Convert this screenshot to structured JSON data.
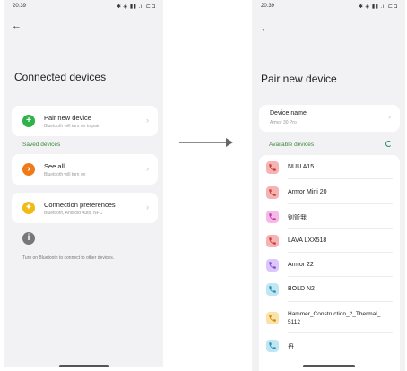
{
  "arrow_color": "#666666",
  "left": {
    "status": {
      "time": "20:39",
      "icons": "✱ ◈ ▮▮ .ıl ⊏⊐"
    },
    "title": "Connected devices",
    "pair": {
      "label": "Pair new device",
      "sub": "Bluetooth will turn on to pair"
    },
    "saved_header": "Saved devices",
    "see_all": {
      "label": "See all",
      "sub": "Bluetooth will turn on"
    },
    "conn_prefs": {
      "label": "Connection preferences",
      "sub": "Bluetooth, Android Auto, NFC"
    },
    "footer": "Turn on Bluetooth to connect to other devices."
  },
  "right": {
    "status": {
      "time": "20:39",
      "icons": "✱ ◈ ▮▮ .ıl ⊏⊐"
    },
    "title": "Pair new device",
    "device_name": {
      "label": "Device name",
      "value": "Armor 30 Pro"
    },
    "available_header": "Available devices",
    "devices": [
      {
        "name": "NUU A15",
        "kind": "phone",
        "color": "#f6b3b3",
        "ink": "#c43c3c"
      },
      {
        "name": "Armor Mini 20",
        "kind": "phone",
        "color": "#f6b3b3",
        "ink": "#c43c3c"
      },
      {
        "name": "别管我",
        "kind": "phone",
        "color": "#f6b8e8",
        "ink": "#b63ea0"
      },
      {
        "name": "LAVA LXX518",
        "kind": "phone",
        "color": "#f6b3b3",
        "ink": "#c43c3c"
      },
      {
        "name": "Armor 22",
        "kind": "phone",
        "color": "#dcc7fb",
        "ink": "#7c4ad0"
      },
      {
        "name": "BOLD N2",
        "kind": "phone",
        "color": "#bfe7f3",
        "ink": "#2a8fae"
      },
      {
        "name": "Hammer_Construction_2_Thermal_\n5112",
        "kind": "phone",
        "color": "#fbe3a8",
        "ink": "#c48a14"
      },
      {
        "name": "丹",
        "kind": "phone",
        "color": "#bfe7f3",
        "ink": "#2a8fae"
      }
    ]
  }
}
